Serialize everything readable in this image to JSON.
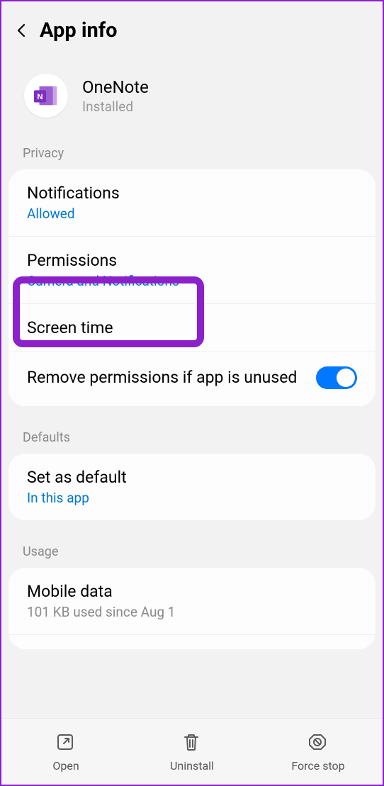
{
  "header": {
    "title": "App info"
  },
  "app": {
    "name": "OneNote",
    "status": "Installed"
  },
  "sections": {
    "privacy_label": "Privacy",
    "defaults_label": "Defaults",
    "usage_label": "Usage"
  },
  "privacy": {
    "notifications": {
      "title": "Notifications",
      "sub": "Allowed"
    },
    "permissions": {
      "title": "Permissions",
      "sub": "Camera and Notifications"
    },
    "screen_time": {
      "title": "Screen time"
    },
    "remove_perms": {
      "title": "Remove permissions if app is unused",
      "toggle_on": true
    }
  },
  "defaults": {
    "set_as_default": {
      "title": "Set as default",
      "sub": "In this app"
    }
  },
  "usage": {
    "mobile_data": {
      "title": "Mobile data",
      "sub": "101 KB used since Aug 1"
    }
  },
  "bottom": {
    "open": "Open",
    "uninstall": "Uninstall",
    "force_stop": "Force stop"
  }
}
